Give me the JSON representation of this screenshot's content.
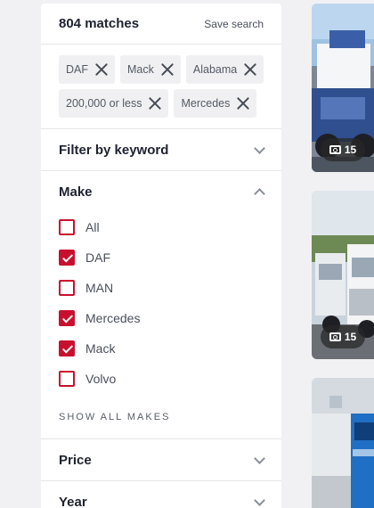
{
  "header": {
    "matches": "804 matches",
    "save_search": "Save search"
  },
  "chips": [
    {
      "label": "DAF"
    },
    {
      "label": "Mack"
    },
    {
      "label": "Alabama"
    },
    {
      "label": "200,000 or less"
    },
    {
      "label": "Mercedes"
    }
  ],
  "sections": {
    "keyword": {
      "title": "Filter by keyword",
      "icon": "chevron-down-icon"
    },
    "make": {
      "title": "Make",
      "icon": "chevron-up-icon"
    },
    "price": {
      "title": "Price",
      "icon": "chevron-down-icon"
    },
    "year": {
      "title": "Year",
      "icon": "chevron-down-icon"
    }
  },
  "makes": [
    {
      "label": "All",
      "checked": false
    },
    {
      "label": "DAF",
      "checked": true
    },
    {
      "label": "MAN",
      "checked": false
    },
    {
      "label": "Mercedes",
      "checked": true
    },
    {
      "label": "Mack",
      "checked": true
    },
    {
      "label": "Volvo",
      "checked": false
    }
  ],
  "show_all_makes": "SHOW ALL MAKES",
  "listings": [
    {
      "photo_count": "15"
    },
    {
      "photo_count": "15"
    },
    {
      "photo_count": ""
    }
  ],
  "colors": {
    "accent": "#c8102e",
    "panel": "#ffffff",
    "background": "#f1f1f3"
  }
}
